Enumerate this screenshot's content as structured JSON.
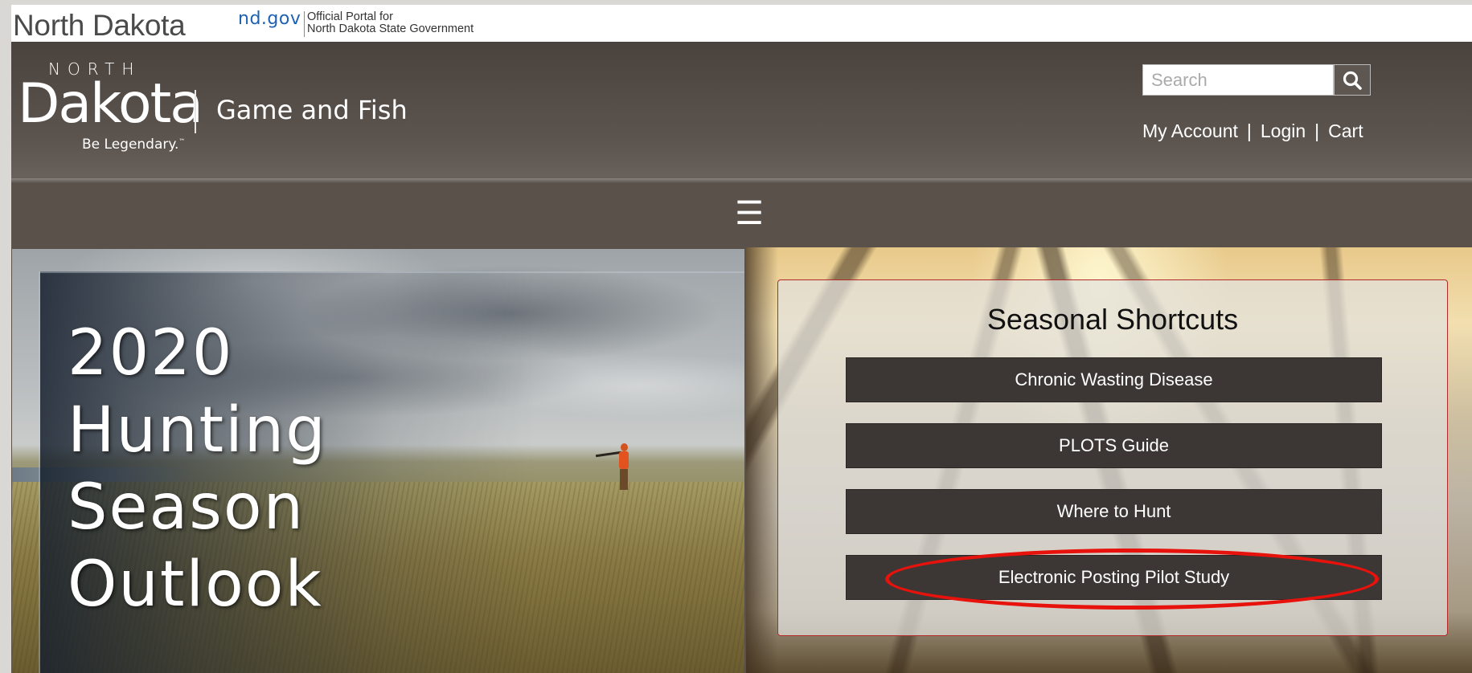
{
  "portal_bar": {
    "state_name": "North Dakota",
    "ndgov_logo": "nd.gov",
    "tagline_line1": "Official Portal for",
    "tagline_line2": "North Dakota State Government"
  },
  "header": {
    "brand_north": "NORTH",
    "brand_dakota": "Dakota",
    "brand_legendary": "Be Legendary.",
    "brand_legendary_mark": "™",
    "department": "Game and Fish",
    "search": {
      "placeholder": "Search",
      "icon": "search-icon"
    },
    "account_links": [
      {
        "label": "My Account"
      },
      {
        "label": "Login"
      },
      {
        "label": "Cart"
      }
    ],
    "separator": "|"
  },
  "nav": {
    "menu_icon": "hamburger-icon",
    "menu_glyph": "☰"
  },
  "hero": {
    "title_lines": [
      "2020",
      "Hunting",
      "Season",
      "Outlook"
    ]
  },
  "shortcuts": {
    "title": "Seasonal Shortcuts",
    "buttons": [
      {
        "label": "Chronic Wasting Disease"
      },
      {
        "label": "PLOTS Guide"
      },
      {
        "label": "Where to Hunt"
      },
      {
        "label": "Electronic Posting Pilot Study"
      }
    ]
  },
  "colors": {
    "header_bg": "#5a514b",
    "button_bg": "#3c3734",
    "ndgov_blue": "#1e62b4",
    "highlight_ring": "#e8120d"
  }
}
